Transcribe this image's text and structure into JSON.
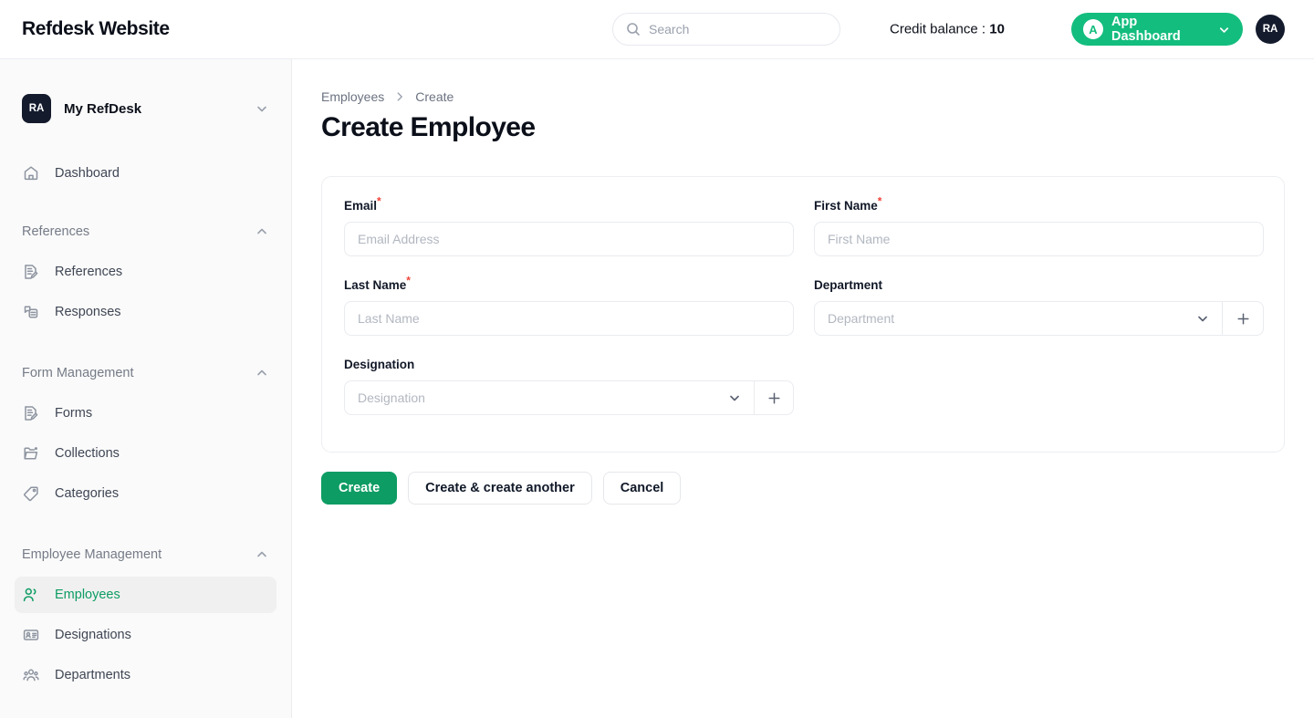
{
  "topbar": {
    "brand": "Refdesk Website",
    "search": {
      "placeholder": "Search",
      "value": "",
      "icon": "search-icon"
    },
    "credit_label": "Credit balance :",
    "credit_value": "10",
    "app_dashboard": {
      "badge": "A",
      "label": "App Dashboard",
      "chevron": "chevron-down-icon",
      "color": "#13bd7e"
    },
    "avatar": "RA"
  },
  "sidebar": {
    "workspace": {
      "badge": "RA",
      "name": "My RefDesk",
      "chevron": "chevron-down-icon"
    },
    "dashboard": {
      "label": "Dashboard",
      "icon": "home-icon"
    },
    "groups": [
      {
        "title": "References",
        "chevron": "chevron-up-icon",
        "items": [
          {
            "label": "References",
            "icon": "document-edit-icon"
          },
          {
            "label": "Responses",
            "icon": "responses-icon"
          }
        ]
      },
      {
        "title": "Form Management",
        "chevron": "chevron-up-icon",
        "items": [
          {
            "label": "Forms",
            "icon": "document-edit-icon"
          },
          {
            "label": "Collections",
            "icon": "folder-icon"
          },
          {
            "label": "Categories",
            "icon": "tag-icon"
          }
        ]
      },
      {
        "title": "Employee Management",
        "chevron": "chevron-up-icon",
        "items": [
          {
            "label": "Employees",
            "icon": "users-icon",
            "active": true
          },
          {
            "label": "Designations",
            "icon": "id-card-icon"
          },
          {
            "label": "Departments",
            "icon": "group-icon"
          }
        ]
      }
    ],
    "active_item": "Employees",
    "active_color": "#0e9c63"
  },
  "main": {
    "breadcrumb": {
      "parent": "Employees",
      "separator": "chevron-right-icon",
      "current": "Create"
    },
    "title": "Create Employee",
    "form": {
      "email": {
        "label": "Email",
        "required": true,
        "placeholder": "Email Address",
        "value": ""
      },
      "first_name": {
        "label": "First Name",
        "required": true,
        "placeholder": "First Name",
        "value": ""
      },
      "last_name": {
        "label": "Last Name",
        "required": true,
        "placeholder": "Last Name",
        "value": ""
      },
      "department": {
        "label": "Department",
        "required": false,
        "placeholder": "Department",
        "value": "",
        "add_icon": "plus-icon",
        "chevron": "chevron-down-icon"
      },
      "designation": {
        "label": "Designation",
        "required": false,
        "placeholder": "Designation",
        "value": "",
        "add_icon": "plus-icon",
        "chevron": "chevron-down-icon"
      }
    },
    "buttons": {
      "create": "Create",
      "create_another": "Create & create another",
      "cancel": "Cancel",
      "primary_color": "#0d9c63"
    },
    "required_marker": "*",
    "required_color": "#f04438"
  }
}
